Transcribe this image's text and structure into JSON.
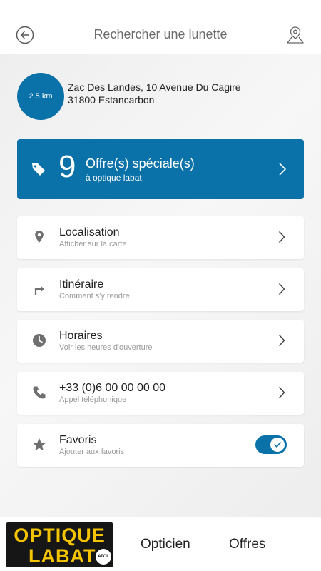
{
  "header": {
    "title": "Rechercher une lunette",
    "back_icon": "back-arrow-circle-icon",
    "map_icon": "map-marker-icon"
  },
  "store": {
    "distance": "2.5 km",
    "address_line1": "Zac Des Landes, 10 Avenue Du Cagire",
    "address_line2": "31800 Estancarbon"
  },
  "offers": {
    "count": "9",
    "title": "Offre(s) spéciale(s)",
    "subtitle": "à optique labat"
  },
  "items": [
    {
      "title": "Localisation",
      "subtitle": "Afficher sur la carte",
      "icon": "location-pin-icon"
    },
    {
      "title": "Itinéraire",
      "subtitle": "Comment s'y rendre",
      "icon": "turn-right-icon"
    },
    {
      "title": "Horaires",
      "subtitle": "Voir les heures d'ouverture",
      "icon": "clock-icon"
    },
    {
      "title": "+33 (0)6 00 00 00 00",
      "subtitle": "Appel téléphonique",
      "icon": "phone-icon"
    },
    {
      "title": "Favoris",
      "subtitle": "Ajouter aux favoris",
      "icon": "star-icon",
      "toggle_on": true
    }
  ],
  "footer": {
    "logo_line1": "OPTIQUE",
    "logo_line2": "LABAT",
    "logo_badge": "ATOL",
    "tab_opticien": "Opticien",
    "tab_offres": "Offres"
  },
  "colors": {
    "accent": "#0a72a9",
    "icon_gray": "#6f6f6f",
    "logo_yellow": "#f4c400"
  }
}
